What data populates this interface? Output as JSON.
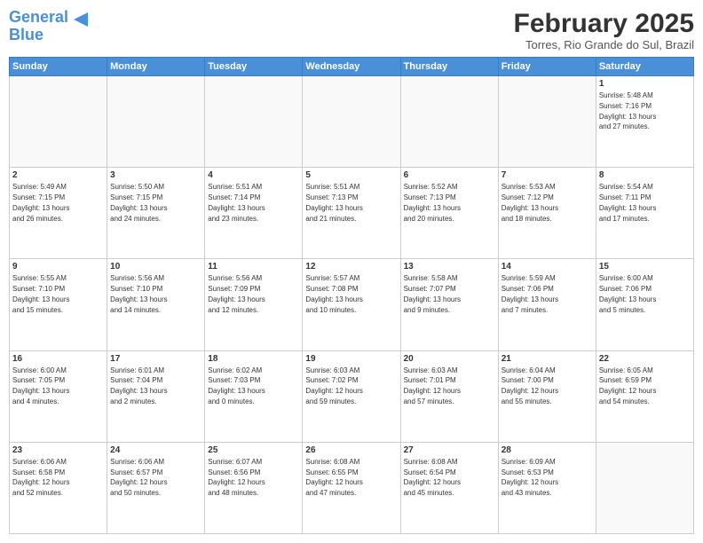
{
  "logo": {
    "line1": "General",
    "line2": "Blue"
  },
  "title": "February 2025",
  "location": "Torres, Rio Grande do Sul, Brazil",
  "weekdays": [
    "Sunday",
    "Monday",
    "Tuesday",
    "Wednesday",
    "Thursday",
    "Friday",
    "Saturday"
  ],
  "weeks": [
    [
      {
        "day": "",
        "info": ""
      },
      {
        "day": "",
        "info": ""
      },
      {
        "day": "",
        "info": ""
      },
      {
        "day": "",
        "info": ""
      },
      {
        "day": "",
        "info": ""
      },
      {
        "day": "",
        "info": ""
      },
      {
        "day": "1",
        "info": "Sunrise: 5:48 AM\nSunset: 7:16 PM\nDaylight: 13 hours\nand 27 minutes."
      }
    ],
    [
      {
        "day": "2",
        "info": "Sunrise: 5:49 AM\nSunset: 7:15 PM\nDaylight: 13 hours\nand 26 minutes."
      },
      {
        "day": "3",
        "info": "Sunrise: 5:50 AM\nSunset: 7:15 PM\nDaylight: 13 hours\nand 24 minutes."
      },
      {
        "day": "4",
        "info": "Sunrise: 5:51 AM\nSunset: 7:14 PM\nDaylight: 13 hours\nand 23 minutes."
      },
      {
        "day": "5",
        "info": "Sunrise: 5:51 AM\nSunset: 7:13 PM\nDaylight: 13 hours\nand 21 minutes."
      },
      {
        "day": "6",
        "info": "Sunrise: 5:52 AM\nSunset: 7:13 PM\nDaylight: 13 hours\nand 20 minutes."
      },
      {
        "day": "7",
        "info": "Sunrise: 5:53 AM\nSunset: 7:12 PM\nDaylight: 13 hours\nand 18 minutes."
      },
      {
        "day": "8",
        "info": "Sunrise: 5:54 AM\nSunset: 7:11 PM\nDaylight: 13 hours\nand 17 minutes."
      }
    ],
    [
      {
        "day": "9",
        "info": "Sunrise: 5:55 AM\nSunset: 7:10 PM\nDaylight: 13 hours\nand 15 minutes."
      },
      {
        "day": "10",
        "info": "Sunrise: 5:56 AM\nSunset: 7:10 PM\nDaylight: 13 hours\nand 14 minutes."
      },
      {
        "day": "11",
        "info": "Sunrise: 5:56 AM\nSunset: 7:09 PM\nDaylight: 13 hours\nand 12 minutes."
      },
      {
        "day": "12",
        "info": "Sunrise: 5:57 AM\nSunset: 7:08 PM\nDaylight: 13 hours\nand 10 minutes."
      },
      {
        "day": "13",
        "info": "Sunrise: 5:58 AM\nSunset: 7:07 PM\nDaylight: 13 hours\nand 9 minutes."
      },
      {
        "day": "14",
        "info": "Sunrise: 5:59 AM\nSunset: 7:06 PM\nDaylight: 13 hours\nand 7 minutes."
      },
      {
        "day": "15",
        "info": "Sunrise: 6:00 AM\nSunset: 7:06 PM\nDaylight: 13 hours\nand 5 minutes."
      }
    ],
    [
      {
        "day": "16",
        "info": "Sunrise: 6:00 AM\nSunset: 7:05 PM\nDaylight: 13 hours\nand 4 minutes."
      },
      {
        "day": "17",
        "info": "Sunrise: 6:01 AM\nSunset: 7:04 PM\nDaylight: 13 hours\nand 2 minutes."
      },
      {
        "day": "18",
        "info": "Sunrise: 6:02 AM\nSunset: 7:03 PM\nDaylight: 13 hours\nand 0 minutes."
      },
      {
        "day": "19",
        "info": "Sunrise: 6:03 AM\nSunset: 7:02 PM\nDaylight: 12 hours\nand 59 minutes."
      },
      {
        "day": "20",
        "info": "Sunrise: 6:03 AM\nSunset: 7:01 PM\nDaylight: 12 hours\nand 57 minutes."
      },
      {
        "day": "21",
        "info": "Sunrise: 6:04 AM\nSunset: 7:00 PM\nDaylight: 12 hours\nand 55 minutes."
      },
      {
        "day": "22",
        "info": "Sunrise: 6:05 AM\nSunset: 6:59 PM\nDaylight: 12 hours\nand 54 minutes."
      }
    ],
    [
      {
        "day": "23",
        "info": "Sunrise: 6:06 AM\nSunset: 6:58 PM\nDaylight: 12 hours\nand 52 minutes."
      },
      {
        "day": "24",
        "info": "Sunrise: 6:06 AM\nSunset: 6:57 PM\nDaylight: 12 hours\nand 50 minutes."
      },
      {
        "day": "25",
        "info": "Sunrise: 6:07 AM\nSunset: 6:56 PM\nDaylight: 12 hours\nand 48 minutes."
      },
      {
        "day": "26",
        "info": "Sunrise: 6:08 AM\nSunset: 6:55 PM\nDaylight: 12 hours\nand 47 minutes."
      },
      {
        "day": "27",
        "info": "Sunrise: 6:08 AM\nSunset: 6:54 PM\nDaylight: 12 hours\nand 45 minutes."
      },
      {
        "day": "28",
        "info": "Sunrise: 6:09 AM\nSunset: 6:53 PM\nDaylight: 12 hours\nand 43 minutes."
      },
      {
        "day": "",
        "info": ""
      }
    ]
  ]
}
